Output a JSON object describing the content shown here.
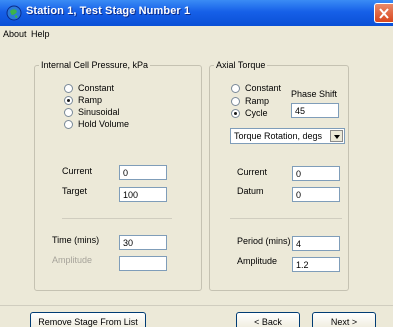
{
  "window": {
    "title": "Station 1, Test Stage Number 1"
  },
  "menu": [
    "About",
    "Help"
  ],
  "pressure_group": {
    "label": "Internal Cell Pressure, kPa",
    "options": [
      "Constant",
      "Ramp",
      "Sinusoidal",
      "Hold Volume"
    ],
    "selected": "Ramp",
    "current_label": "Current",
    "current_value": "0",
    "target_label": "Target",
    "target_value": "100",
    "time_label": "Time (mins)",
    "time_value": "30",
    "amplitude_label": "Amplitude",
    "amplitude_value": ""
  },
  "torque_group": {
    "label": "Axial Torque",
    "options": [
      "Constant",
      "Ramp",
      "Cycle"
    ],
    "selected": "Cycle",
    "phase_shift_label": "Phase Shift",
    "phase_shift_value": "45",
    "units_select": "Torque Rotation, degs",
    "current_label": "Current",
    "current_value": "0",
    "datum_label": "Datum",
    "datum_value": "0",
    "period_label": "Period (mins)",
    "period_value": "4",
    "amplitude_label": "Amplitude",
    "amplitude_value": "1.2"
  },
  "buttons": {
    "remove_stage": "Remove Stage From List",
    "back": "< Back",
    "next": "Next >"
  },
  "colors": {
    "titlebar": "#0a4fd6",
    "window_bg": "#ece9d8",
    "close_button": "#d9471e"
  }
}
